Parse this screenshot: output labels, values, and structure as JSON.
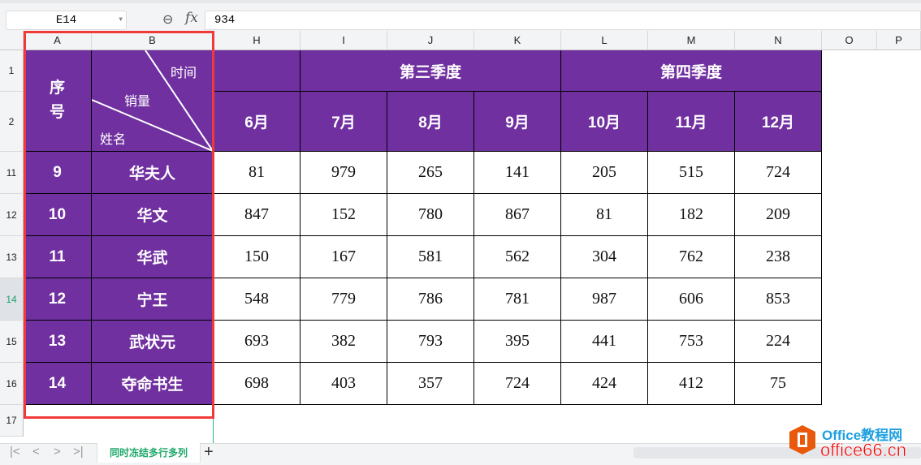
{
  "formula_bar": {
    "name_box": "E14",
    "formula": "934",
    "zoom_icon": "zoom-out-icon",
    "fx": "fx"
  },
  "columns": [
    "A",
    "B",
    "H",
    "I",
    "J",
    "K",
    "L",
    "M",
    "N",
    "O",
    "P"
  ],
  "row_numbers": [
    "1",
    "2",
    "11",
    "12",
    "13",
    "14",
    "15",
    "16",
    "17"
  ],
  "selected_row": "14",
  "header": {
    "seq": "序号",
    "time": "时间",
    "sales": "销量",
    "name": "姓名",
    "q3": "第三季度",
    "q4": "第四季度",
    "months": [
      "6月",
      "7月",
      "8月",
      "9月",
      "10月",
      "11月",
      "12月"
    ]
  },
  "rows": [
    {
      "id": "9",
      "name": "华夫人",
      "values": [
        "81",
        "979",
        "265",
        "141",
        "205",
        "515",
        "724"
      ]
    },
    {
      "id": "10",
      "name": "华文",
      "values": [
        "847",
        "152",
        "780",
        "867",
        "81",
        "182",
        "209"
      ]
    },
    {
      "id": "11",
      "name": "华武",
      "values": [
        "150",
        "167",
        "581",
        "562",
        "304",
        "762",
        "238"
      ]
    },
    {
      "id": "12",
      "name": "宁王",
      "values": [
        "548",
        "779",
        "786",
        "781",
        "987",
        "606",
        "853"
      ]
    },
    {
      "id": "13",
      "name": "武状元",
      "values": [
        "693",
        "382",
        "793",
        "395",
        "441",
        "753",
        "224"
      ]
    },
    {
      "id": "14",
      "name": "夺命书生",
      "values": [
        "698",
        "403",
        "357",
        "724",
        "424",
        "412",
        "75"
      ]
    }
  ],
  "sheet_tab": "同时冻结多行多列",
  "watermark": {
    "line1": "Office教程网",
    "line2": "office66.cn"
  },
  "colors": {
    "header_fill": "#7030A0",
    "highlight_box": "#f03a3a"
  }
}
